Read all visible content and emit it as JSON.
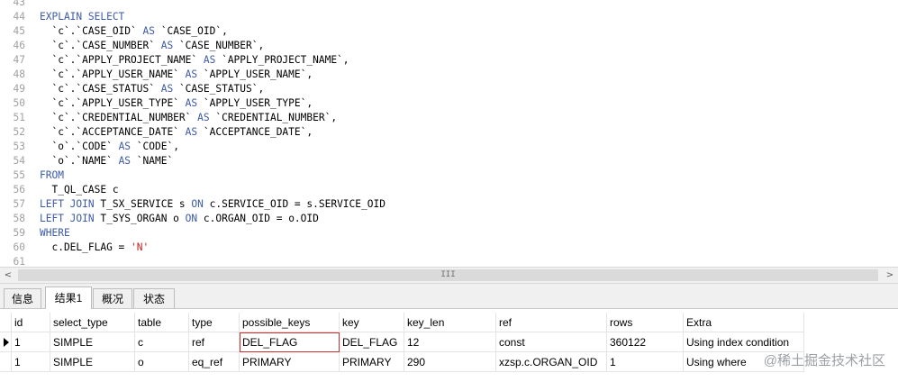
{
  "editor": {
    "lines": [
      {
        "n": "43",
        "tokens": []
      },
      {
        "n": "44",
        "tokens": [
          {
            "t": "EXPLAIN SELECT",
            "c": "kw"
          }
        ]
      },
      {
        "n": "45",
        "tokens": [
          {
            "t": "  `c`.`CASE_OID` ",
            "c": ""
          },
          {
            "t": "AS",
            "c": "kw"
          },
          {
            "t": " `CASE_OID`,",
            "c": ""
          }
        ]
      },
      {
        "n": "46",
        "tokens": [
          {
            "t": "  `c`.`CASE_NUMBER` ",
            "c": ""
          },
          {
            "t": "AS",
            "c": "kw"
          },
          {
            "t": " `CASE_NUMBER`,",
            "c": ""
          }
        ]
      },
      {
        "n": "47",
        "tokens": [
          {
            "t": "  `c`.`APPLY_PROJECT_NAME` ",
            "c": ""
          },
          {
            "t": "AS",
            "c": "kw"
          },
          {
            "t": " `APPLY_PROJECT_NAME`,",
            "c": ""
          }
        ]
      },
      {
        "n": "48",
        "tokens": [
          {
            "t": "  `c`.`APPLY_USER_NAME` ",
            "c": ""
          },
          {
            "t": "AS",
            "c": "kw"
          },
          {
            "t": " `APPLY_USER_NAME`,",
            "c": ""
          }
        ]
      },
      {
        "n": "49",
        "tokens": [
          {
            "t": "  `c`.`CASE_STATUS` ",
            "c": ""
          },
          {
            "t": "AS",
            "c": "kw"
          },
          {
            "t": " `CASE_STATUS`,",
            "c": ""
          }
        ]
      },
      {
        "n": "50",
        "tokens": [
          {
            "t": "  `c`.`APPLY_USER_TYPE` ",
            "c": ""
          },
          {
            "t": "AS",
            "c": "kw"
          },
          {
            "t": " `APPLY_USER_TYPE`,",
            "c": ""
          }
        ]
      },
      {
        "n": "51",
        "tokens": [
          {
            "t": "  `c`.`CREDENTIAL_NUMBER` ",
            "c": ""
          },
          {
            "t": "AS",
            "c": "kw"
          },
          {
            "t": " `CREDENTIAL_NUMBER`,",
            "c": ""
          }
        ]
      },
      {
        "n": "52",
        "tokens": [
          {
            "t": "  `c`.`ACCEPTANCE_DATE` ",
            "c": ""
          },
          {
            "t": "AS",
            "c": "kw"
          },
          {
            "t": " `ACCEPTANCE_DATE`,",
            "c": ""
          }
        ]
      },
      {
        "n": "53",
        "tokens": [
          {
            "t": "  `o`.`CODE` ",
            "c": ""
          },
          {
            "t": "AS",
            "c": "kw"
          },
          {
            "t": " `CODE`,",
            "c": ""
          }
        ]
      },
      {
        "n": "54",
        "tokens": [
          {
            "t": "  `o`.`NAME` ",
            "c": ""
          },
          {
            "t": "AS",
            "c": "kw"
          },
          {
            "t": " `NAME`",
            "c": ""
          }
        ]
      },
      {
        "n": "55",
        "tokens": [
          {
            "t": "FROM",
            "c": "kw"
          }
        ]
      },
      {
        "n": "56",
        "tokens": [
          {
            "t": "  T_QL_CASE c",
            "c": ""
          }
        ]
      },
      {
        "n": "57",
        "tokens": [
          {
            "t": "LEFT JOIN",
            "c": "kw"
          },
          {
            "t": " T_SX_SERVICE s ",
            "c": ""
          },
          {
            "t": "ON",
            "c": "kw"
          },
          {
            "t": " c.SERVICE_OID = s.SERVICE_OID",
            "c": ""
          }
        ]
      },
      {
        "n": "58",
        "tokens": [
          {
            "t": "LEFT JOIN",
            "c": "kw"
          },
          {
            "t": " T_SYS_ORGAN o ",
            "c": ""
          },
          {
            "t": "ON",
            "c": "kw"
          },
          {
            "t": " c.ORGAN_OID = o.OID",
            "c": ""
          }
        ]
      },
      {
        "n": "59",
        "tokens": [
          {
            "t": "WHERE",
            "c": "kw"
          }
        ]
      },
      {
        "n": "60",
        "tokens": [
          {
            "t": "  c.DEL_FLAG = ",
            "c": ""
          },
          {
            "t": "'N'",
            "c": "str"
          }
        ]
      },
      {
        "n": "61",
        "tokens": []
      }
    ]
  },
  "scrollbar": {
    "left_arrow": "<",
    "right_arrow": ">",
    "grip": "III"
  },
  "tabs": [
    {
      "label": "信息",
      "active": false
    },
    {
      "label": "结果1",
      "active": true
    },
    {
      "label": "概况",
      "active": false
    },
    {
      "label": "状态",
      "active": false
    }
  ],
  "result": {
    "columns": [
      "id",
      "select_type",
      "table",
      "type",
      "possible_keys",
      "key",
      "key_len",
      "ref",
      "rows",
      "Extra"
    ],
    "rows": [
      [
        "1",
        "SIMPLE",
        "c",
        "ref",
        "DEL_FLAG",
        "DEL_FLAG",
        "12",
        "const",
        "360122",
        "Using index condition"
      ],
      [
        "1",
        "SIMPLE",
        "o",
        "eq_ref",
        "PRIMARY",
        "PRIMARY",
        "290",
        "xzsp.c.ORGAN_OID",
        "1",
        "Using where"
      ]
    ],
    "current_row": 0,
    "selected_cell": {
      "row": 0,
      "col": 4
    }
  },
  "watermark": "@稀土掘金技术社区"
}
